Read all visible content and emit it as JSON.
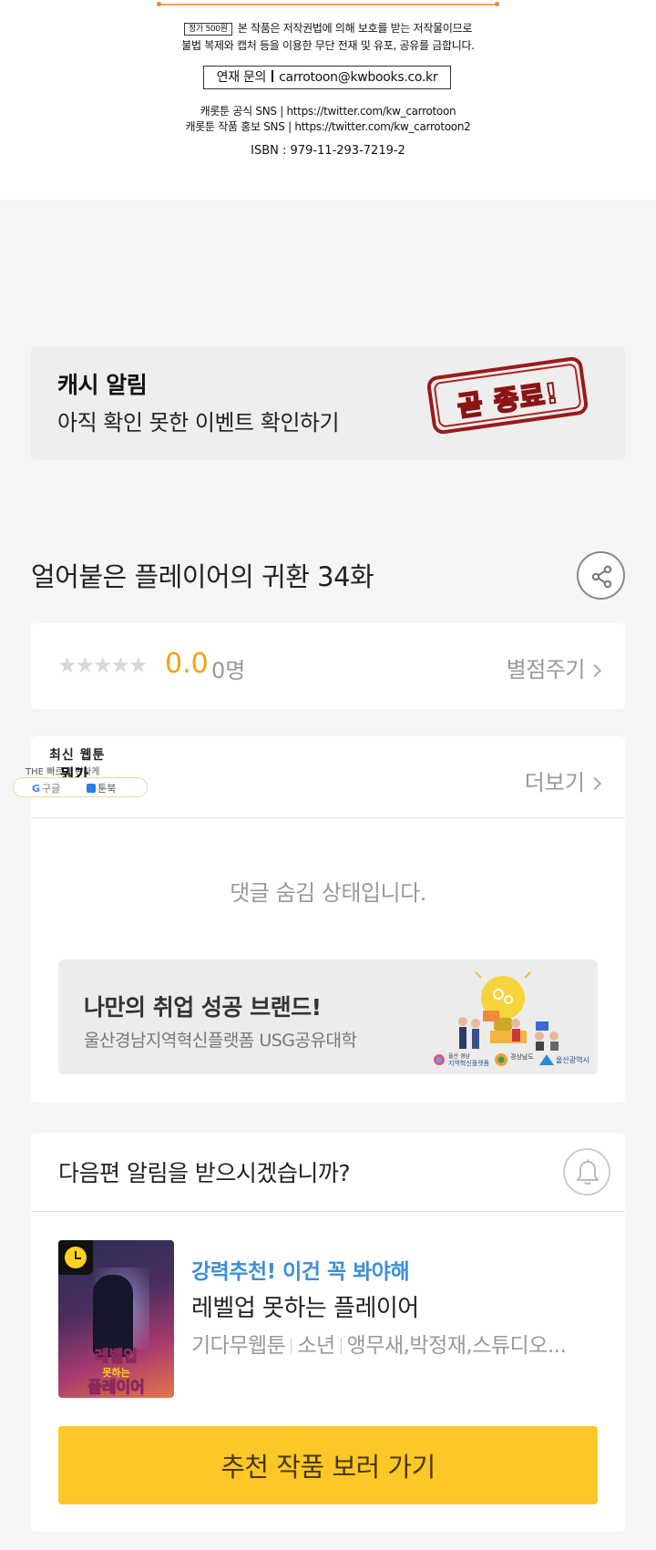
{
  "notice": {
    "price_tag": "정가 500원",
    "line1": "본 작품은 저작권법에 의해 보호를 받는 저작물이므로",
    "line2": "불법 복제와 캡처 등을 이용한 무단 전재 및 유포, 공유를 금합니다.",
    "contact_label": "연재 문의",
    "contact_email": "carrotoon@kwbooks.co.kr",
    "sns1": "캐롯툰 공식 SNS | https://twitter.com/kw_carrotoon",
    "sns2": "캐롯툰 작품 홍보 SNS | https://twitter.com/kw_carrotoon2",
    "isbn": "ISBN : 979-11-293-7219-2"
  },
  "cash_banner": {
    "title": "캐시 알림",
    "subtitle": "아직 확인 못한 이벤트 확인하기",
    "stamp_text": "곧 종료!"
  },
  "episode": {
    "title": "얼어붙은 플레이어의 귀환 34화",
    "share_icon": "share-icon"
  },
  "rating": {
    "stars": "★★★★★",
    "score": "0.0",
    "count": "0명",
    "rate_label": "별점주기",
    "star_value": 0
  },
  "comments": {
    "more_label": "더보기",
    "hidden_message": "댓글 숨김 상태입니다."
  },
  "ad": {
    "headline": "나만의 취업 성공 브랜드!",
    "sub": "울산경남지역혁신플랫폼 USG공유대학"
  },
  "float_widget": {
    "title": "최신 웹툰",
    "sub": "THE 빠르고 편하게",
    "big": "뭔가",
    "google": "구글",
    "toon": "툰북"
  },
  "next_episode": {
    "question": "다음편 알림을 받으시겠습니까?",
    "bell_icon": "bell-icon",
    "recommend_tag": "강력추천! 이건 꼭 봐야해",
    "recommend_title": "레벨업 못하는 플레이어",
    "thumb_caption_top": "레벨업",
    "thumb_caption_mid": "못하는",
    "thumb_caption_bottom": "플레이어",
    "meta": [
      "기다무웹툰",
      "소년",
      "앵무새,박정재,스튜디오..."
    ],
    "cta_label": "추천 작품 보러 가기"
  },
  "colors": {
    "accent_yellow": "#fdc727",
    "score_orange": "#f4a20a",
    "recommend_blue": "#3c8fd8",
    "stamp_red": "#9b1a1a"
  }
}
